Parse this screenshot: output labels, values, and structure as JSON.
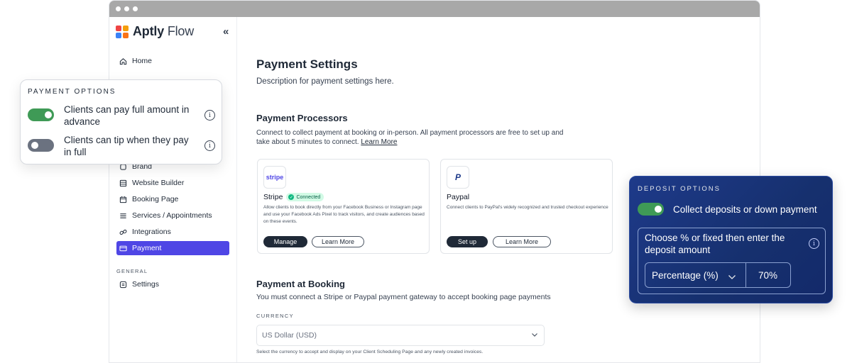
{
  "brand": {
    "name_bold": "Aptly",
    "name_light": "Flow"
  },
  "sidebar": {
    "items": [
      {
        "label": "Home"
      },
      {
        "label": "Brand"
      },
      {
        "label": "Website Builder"
      },
      {
        "label": "Booking Page"
      },
      {
        "label": "Services / Appointments"
      },
      {
        "label": "Integrations"
      },
      {
        "label": "Payment"
      }
    ],
    "general_label": "GENERAL",
    "general_items": [
      {
        "label": "Settings"
      }
    ]
  },
  "main": {
    "title": "Payment Settings",
    "description": "Description for payment settings here.",
    "processors": {
      "heading": "Payment Processors",
      "text_line1": "Connect to collect payment at booking or in-person. All payment processors are free to set up and",
      "text_line2": "take about 5 minutes to connect.",
      "learn_more": "Learn More",
      "cards": [
        {
          "icon_text": "stripe",
          "name": "Stripe",
          "badge": "Connected",
          "desc": "Allow clients to book directly from your Facebook Business or Instagram  page and use your Facebook Ads Pixel to track visitors, and create  audiences based on these events.",
          "primary_btn": "Manage",
          "secondary_btn": "Learn More"
        },
        {
          "icon_text": "P",
          "name": "Paypal",
          "desc": "Connect clients to PayPal's widely recognized and trusted checkout experience",
          "primary_btn": "Set up",
          "secondary_btn": "Learn More"
        }
      ]
    },
    "booking": {
      "heading": "Payment at Booking",
      "text": "You must connect a Stripe or Paypal payment gateway to accept booking page payments",
      "currency_label": "CURRENCY",
      "currency_value": "US Dollar (USD)",
      "currency_help": "Select the currency to accept and display on your Client Scheduling Page and any newly created invoices."
    }
  },
  "payment_options": {
    "title": "PAYMENT OPTIONS",
    "options": [
      {
        "line1": "Clients can pay full amount in",
        "line2": "advance",
        "enabled": true
      },
      {
        "line1": "Clients can tip when they pay",
        "line2": "in full",
        "enabled": false
      }
    ]
  },
  "deposit_options": {
    "title": "DEPOSIT OPTIONS",
    "toggle_label": "Collect deposits or down payment",
    "toggle_enabled": true,
    "box_line1": "Choose % or fixed then enter the",
    "box_line2": "deposit amount",
    "type_value": "Percentage (%)",
    "amount_value": "70%"
  },
  "colors": {
    "accent": "#4f46e5",
    "toggle_on": "#3f9a56",
    "toggle_off": "#6b7280",
    "deposit_panel": "#1e3a8a"
  }
}
